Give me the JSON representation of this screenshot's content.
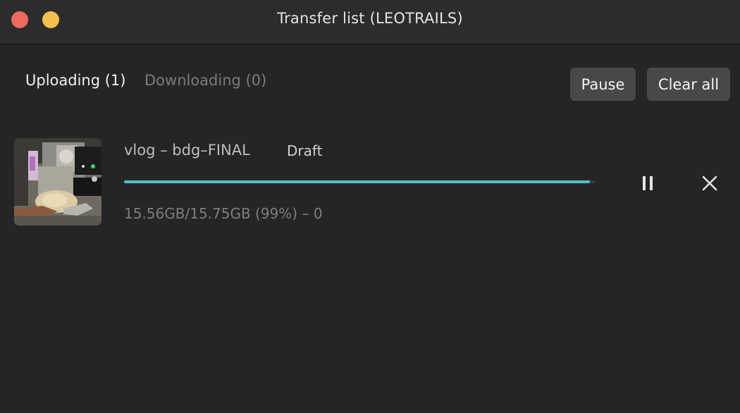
{
  "window": {
    "title": "Transfer list (LEOTRAILS)"
  },
  "tabs": [
    {
      "label": "Uploading (1)",
      "active": true
    },
    {
      "label": "Downloading (0)",
      "active": false
    }
  ],
  "toolbar": {
    "pause_label": "Pause",
    "clear_label": "Clear all"
  },
  "transfers": [
    {
      "name": "vlog – bdg–FINAL",
      "badge": "Draft",
      "progress_percent": 99,
      "progress_text": "15.56GB/15.75GB (99%) – 0",
      "thumbnail": "video-thumbnail",
      "pause_icon": "pause-icon",
      "close_icon": "close-icon"
    }
  ],
  "colors": {
    "background": "#252525",
    "titlebar": "#2c2c2c",
    "button": "#48484a",
    "progress": "#53bfd0",
    "close_light": "#ed6a5e",
    "minimize_light": "#f5bf4f"
  }
}
